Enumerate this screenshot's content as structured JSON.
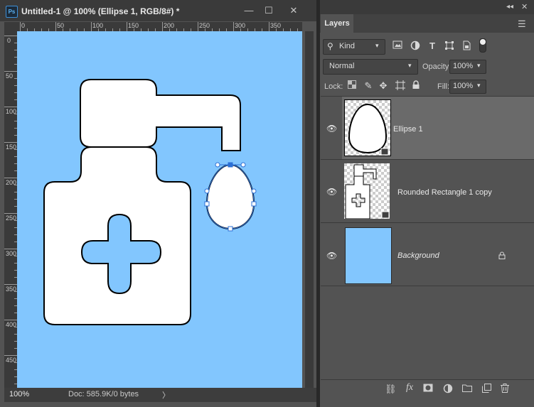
{
  "document": {
    "title": "Untitled-1 @ 100% (Ellipse 1, RGB/8#) *",
    "app_icon": "Ps",
    "minimize_glyph": "—",
    "maximize_glyph": "☐",
    "close_glyph": "✕",
    "ruler_top_labels": [
      "0",
      "50",
      "100",
      "150",
      "200",
      "250",
      "300",
      "350"
    ],
    "ruler_left_labels": [
      "0",
      "50",
      "100",
      "150",
      "200",
      "250",
      "300",
      "350",
      "400",
      "450"
    ],
    "canvas_color": "#82c6fe",
    "zoom": "100%",
    "doc_info": "Doc: 585.9K/0 bytes",
    "status_arrow": "〉"
  },
  "layers_panel": {
    "tab_label": "Layers",
    "kind_label": "Kind",
    "blend_mode": "Normal",
    "opacity_label": "Opacity:",
    "opacity_value": "100%",
    "lock_label": "Lock:",
    "fill_label": "Fill:",
    "fill_value": "100%",
    "layers": [
      {
        "name": "Ellipse 1",
        "selected": true,
        "visible": true
      },
      {
        "name": "Rounded Rectangle 1 copy",
        "selected": false,
        "visible": true
      },
      {
        "name": "Background",
        "selected": false,
        "visible": true,
        "locked": true,
        "thumb_color": "#82c6fe"
      }
    ]
  },
  "icons": {
    "filter_icons": [
      "image-filter-icon",
      "adjustment-filter-icon",
      "type-filter-icon",
      "shape-filter-icon",
      "smart-object-filter-icon",
      "filter-toggle-icon"
    ],
    "lock_icons": [
      "lock-transparent-icon",
      "lock-image-icon",
      "lock-position-icon",
      "lock-artboard-icon",
      "lock-all-icon"
    ],
    "footer_icons": [
      "link-layers-icon",
      "fx-icon",
      "add-mask-icon",
      "adjustment-layer-icon",
      "new-group-icon",
      "new-layer-icon",
      "trash-icon"
    ]
  },
  "footer": {
    "fx_label": "fx"
  }
}
